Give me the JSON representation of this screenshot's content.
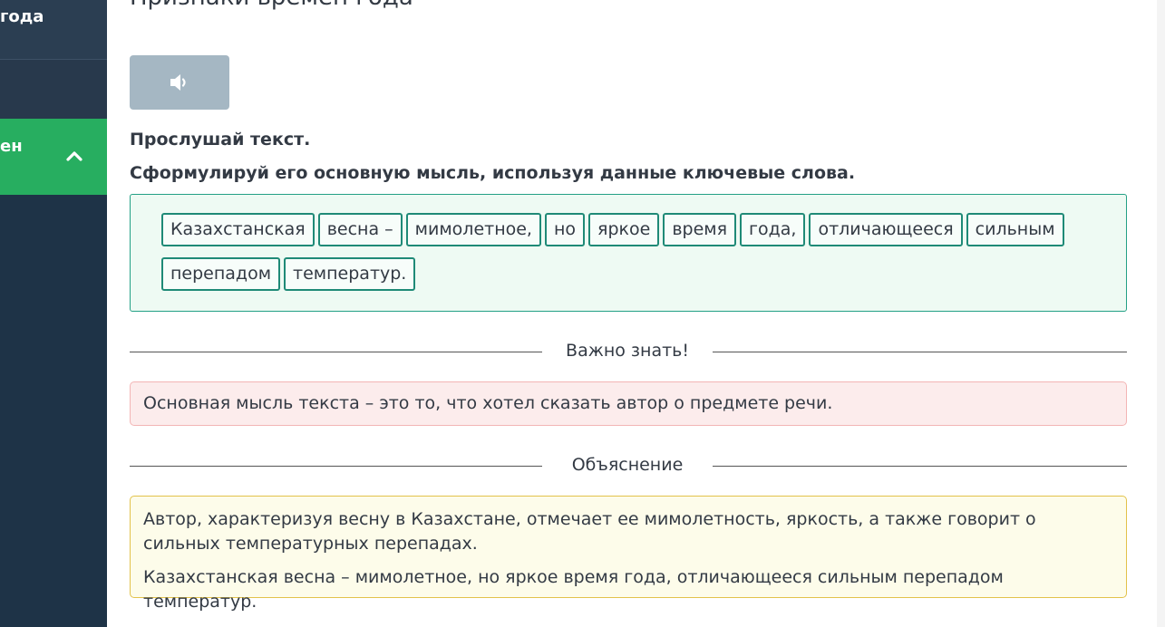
{
  "sidebar": {
    "item1_label": "года",
    "item3_label": "ен"
  },
  "lesson": {
    "title": "Признаки времен года",
    "instruction1": "Прослушай текст.",
    "instruction2": "Сформулируй его основную мысль, используя данные ключевые слова.",
    "words": [
      "Казахстанская",
      "весна –",
      "мимолетное,",
      "но",
      "яркое",
      "время",
      "года,",
      "отличающееся",
      "сильным",
      "перепадом",
      "температур."
    ]
  },
  "important": {
    "heading": "Важно знать!",
    "text": "Основная мысль текста – это то, что хотел сказать автор о предмете речи."
  },
  "explanation": {
    "heading": "Объяснение",
    "text1": "Автор, характеризуя весну в Казахстане, отмечает ее мимолетность, яркость, а также говорит о сильных температурных перепадах.",
    "text2": "Казахстанская весна – мимолетное, но яркое время года, отличающееся сильным перепадом температур."
  },
  "icons": {
    "audio": "speaker-icon",
    "collapse": "chevron-up-icon"
  },
  "colors": {
    "sidebar": "#1e3347",
    "active": "#27ae60",
    "chip_border": "#1f8a77",
    "audio_button": "#a5b7c3"
  }
}
